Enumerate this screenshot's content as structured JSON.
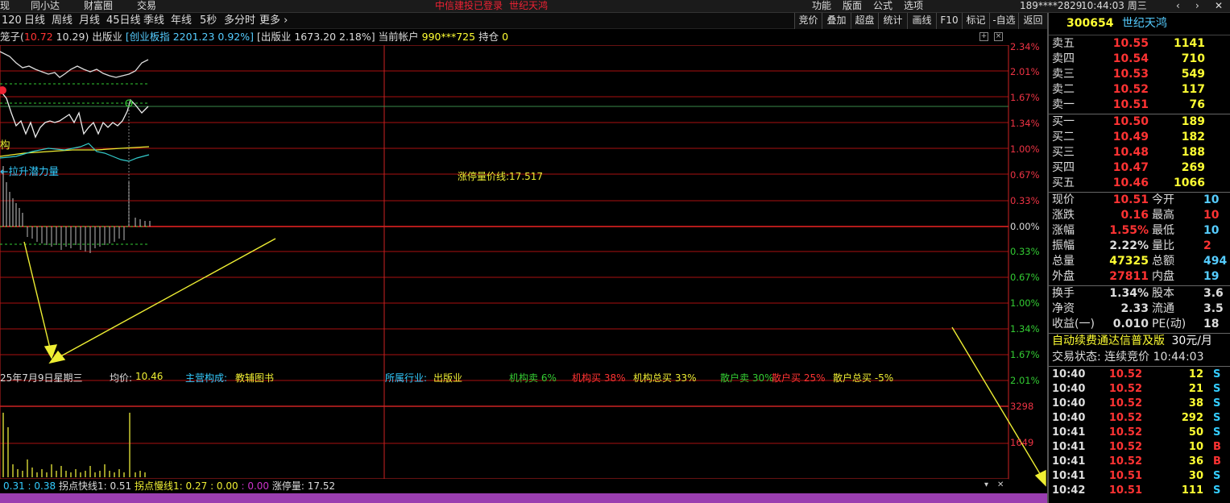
{
  "topbar": {
    "left_items": [
      "现",
      "同小达",
      "财富圈",
      "交易"
    ],
    "login_status": "中信建投已登录",
    "stock_name": "世纪天鸿",
    "right_items": [
      "功能",
      "版面",
      "公式",
      "选项"
    ],
    "account": "189****2829",
    "clock": "10:44:03 周三",
    "arrows": [
      "‹",
      "›"
    ],
    "close_glyph": "✕"
  },
  "periods": [
    "120",
    "日线",
    "周线",
    "月线",
    "45日线",
    "季线",
    "年线",
    "5秒",
    "多分时",
    "更多 ›"
  ],
  "toolbar": [
    "竞价",
    "叠加",
    "超盘",
    "统计",
    "画线",
    "F10",
    "标记",
    "-自选",
    "返回"
  ],
  "info_line": {
    "label": "笼子(",
    "upper": "10.72",
    "lower": "10.29",
    "close": ")",
    "industry": "出版业",
    "index_name": "[创业板指",
    "index_value": "2201.23",
    "index_pct": "0.92%]",
    "sector_name": "[出版业",
    "sector_value": "1673.20",
    "sector_pct": "2.18%]",
    "account_label": "当前帐户",
    "account_no": "990***725",
    "position_label": "持仓",
    "position_value": "0"
  },
  "chart_labels": {
    "limit_line": "涨停量价线:17.517",
    "label_gou": "构",
    "label_lift": "←拉升潜力量"
  },
  "y_axis_right": [
    "2.34%",
    "2.01%",
    "1.67%",
    "1.34%",
    "1.00%",
    "0.67%",
    "0.33%",
    "0.00%",
    "0.33%",
    "0.67%",
    "1.00%",
    "1.34%",
    "1.67%",
    "2.01%"
  ],
  "volume_axis": [
    "3298",
    "1649"
  ],
  "stats": {
    "date": "25年7月9日星期三",
    "avg_label": "均价:",
    "avg_value": "10.46",
    "main_label": "主营构成:",
    "main_value": "教辅图书",
    "ind_label": "所属行业:",
    "ind_value": "出版业",
    "inst_sell": "机构卖 6%",
    "inst_buy": "机构买 38%",
    "inst_total": "机构总买 33%",
    "retail_sell": "散户卖 30%",
    "retail_buy": "散户买 25%",
    "retail_total": "散户总买 -5%"
  },
  "bottom_line": {
    "v1": "0.31",
    "v2": ": 0.38",
    "fast_label": "拐点快线1:",
    "fast_value": "0.51",
    "slow_label": "拐点慢线1:",
    "slow_value": "0.27",
    "z1": ": 0.00",
    "z2": ": 0.00",
    "limit_label": "涨停量:",
    "limit_value": "17.52",
    "dropdown_glyph": "▾",
    "close_glyph": "✕"
  },
  "quote": {
    "code": "300654",
    "name": "世纪天鸿",
    "asks": [
      {
        "label": "卖五",
        "price": "10.55",
        "vol": "1141"
      },
      {
        "label": "卖四",
        "price": "10.54",
        "vol": "710"
      },
      {
        "label": "卖三",
        "price": "10.53",
        "vol": "549"
      },
      {
        "label": "卖二",
        "price": "10.52",
        "vol": "117"
      },
      {
        "label": "卖一",
        "price": "10.51",
        "vol": "76"
      }
    ],
    "bids": [
      {
        "label": "买一",
        "price": "10.50",
        "vol": "189"
      },
      {
        "label": "买二",
        "price": "10.49",
        "vol": "182"
      },
      {
        "label": "买三",
        "price": "10.48",
        "vol": "188"
      },
      {
        "label": "买四",
        "price": "10.47",
        "vol": "269"
      },
      {
        "label": "买五",
        "price": "10.46",
        "vol": "1066"
      }
    ],
    "stats": [
      {
        "l1": "现价",
        "v1": "10.51",
        "c1": "#f33",
        "l2": "今开",
        "v2": "10",
        "c2": "#5cf"
      },
      {
        "l1": "涨跌",
        "v1": "0.16",
        "c1": "#f33",
        "l2": "最高",
        "v2": "10",
        "c2": "#f33"
      },
      {
        "l1": "涨幅",
        "v1": "1.55%",
        "c1": "#f33",
        "l2": "最低",
        "v2": "10",
        "c2": "#5cf"
      },
      {
        "l1": "振幅",
        "v1": "2.22%",
        "c1": "#ddd",
        "l2": "量比",
        "v2": "2",
        "c2": "#f33"
      },
      {
        "l1": "总量",
        "v1": "47325",
        "c1": "#ff3",
        "l2": "总额",
        "v2": "494",
        "c2": "#5cf"
      },
      {
        "l1": "外盘",
        "v1": "27811",
        "c1": "#f33",
        "l2": "内盘",
        "v2": "19",
        "c2": "#5cf"
      }
    ],
    "stats2": [
      {
        "l1": "换手",
        "v1": "1.34%",
        "c1": "#ddd",
        "l2": "股本",
        "v2": "3.6",
        "c2": "#ddd"
      },
      {
        "l1": "净资",
        "v1": "2.33",
        "c1": "#ddd",
        "l2": "流通",
        "v2": "3.5",
        "c2": "#ddd"
      },
      {
        "l1": "收益(一)",
        "v1": "0.010",
        "c1": "#ddd",
        "l2": "PE(动)",
        "v2": "18",
        "c2": "#ddd"
      }
    ],
    "ad_text": "自动续费通达信普及版",
    "ad_price": "30元/月",
    "trade_status": "交易状态: 连续竞价 10:44:03"
  },
  "ticks": [
    {
      "t": "10:40",
      "p": "10.52",
      "v": "12",
      "bs": "S"
    },
    {
      "t": "10:40",
      "p": "10.52",
      "v": "21",
      "bs": "S"
    },
    {
      "t": "10:40",
      "p": "10.52",
      "v": "38",
      "bs": "S"
    },
    {
      "t": "10:40",
      "p": "10.52",
      "v": "292",
      "bs": "S"
    },
    {
      "t": "10:41",
      "p": "10.52",
      "v": "50",
      "bs": "S"
    },
    {
      "t": "10:41",
      "p": "10.52",
      "v": "10",
      "bs": "B"
    },
    {
      "t": "10:41",
      "p": "10.52",
      "v": "36",
      "bs": "B"
    },
    {
      "t": "10:41",
      "p": "10.51",
      "v": "30",
      "bs": "S"
    },
    {
      "t": "10:42",
      "p": "10.51",
      "v": "111",
      "bs": "S"
    }
  ]
}
